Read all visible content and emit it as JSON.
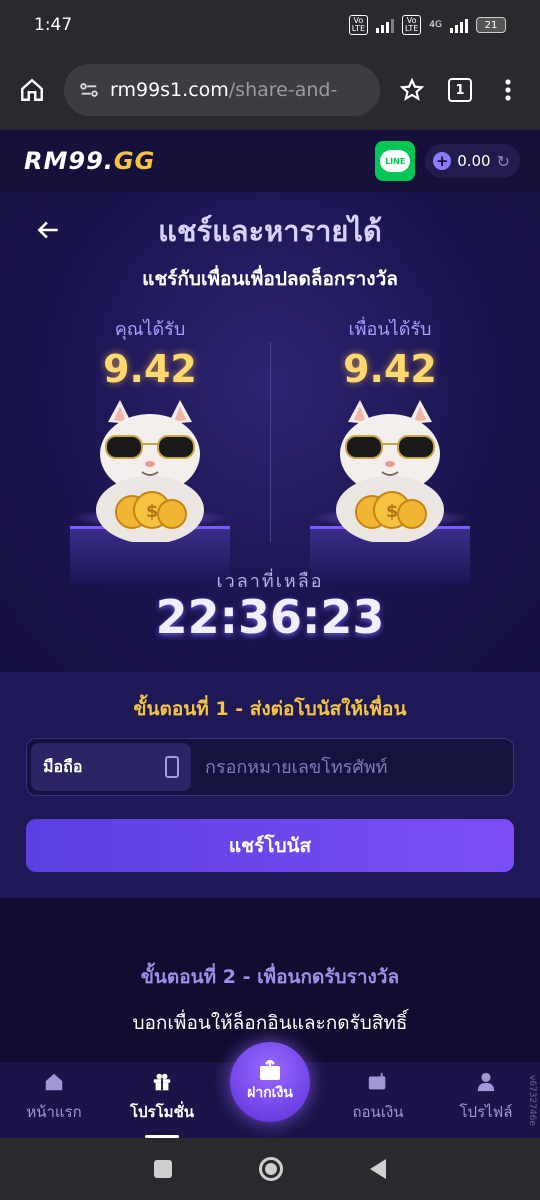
{
  "status_bar": {
    "time": "1:47",
    "battery": "21",
    "network": "4G",
    "volte_label": "Vo LTE"
  },
  "browser": {
    "url_host": "rm99s1.com",
    "url_path": "/share-and-",
    "tab_count": "1",
    "home_icon": "home-icon",
    "menu_icon": "more-vert-icon",
    "bookmark_icon": "star-icon"
  },
  "header": {
    "logo_main": "RM99.",
    "logo_suffix": "GG",
    "line_label": "LINE",
    "balance": "0.00",
    "accent": "#7b4ff5",
    "gold": "#f5c542"
  },
  "hero": {
    "title": "แชร์และหารายได้",
    "subtitle": "แชร์กับเพื่อนเพื่อปลดล็อกรางวัล",
    "you_label": "คุณได้รับ",
    "you_amount": "9.42",
    "friend_label": "เพื่อนได้รับ",
    "friend_amount": "9.42",
    "time_label": "เวลาที่เหลือ",
    "timer": "22:36:23"
  },
  "step1": {
    "title": "ขั้นตอนที่ 1 - ส่งต่อโบนัสให้เพื่อน",
    "phone_type": "มือถือ",
    "phone_placeholder": "กรอกหมายเลขโทรศัพท์",
    "phone_value": "",
    "share_button": "แชร์โบนัส"
  },
  "step2": {
    "title": "ขั้นตอนที่ 2 - เพื่อนกดรับรางวัล",
    "description": "บอกเพื่อนให้ล็อกอินและกดรับสิทธิ์"
  },
  "bottom_nav": {
    "home": "หน้าแรก",
    "promotions": "โปรโมชั่น",
    "deposit": "ฝากเงิน",
    "withdraw": "ถอนเงิน",
    "profile": "โปรไฟล์",
    "version": "v6732746e"
  }
}
